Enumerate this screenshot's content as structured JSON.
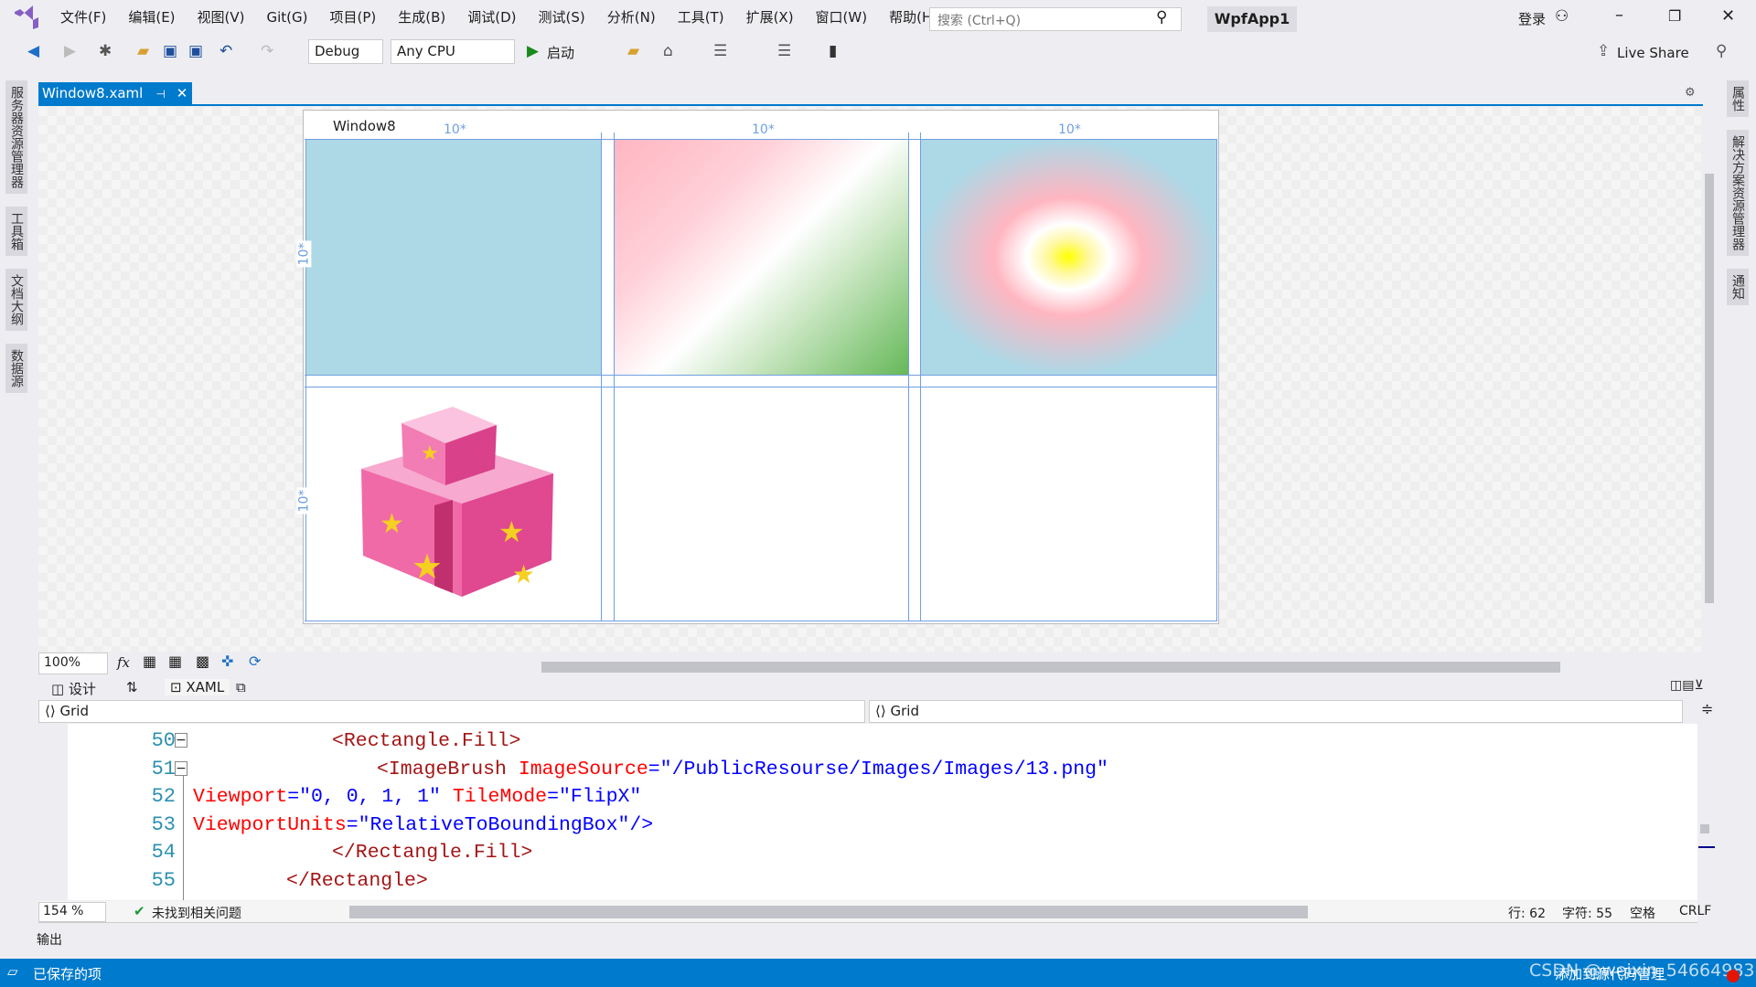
{
  "menubar": {
    "items": [
      "文件(F)",
      "编辑(E)",
      "视图(V)",
      "Git(G)",
      "项目(P)",
      "生成(B)",
      "调试(D)",
      "测试(S)",
      "分析(N)",
      "工具(T)",
      "扩展(X)",
      "窗口(W)",
      "帮助(H)"
    ],
    "search_placeholder": "搜索 (Ctrl+Q)",
    "app_name": "WpfApp1",
    "login": "登录"
  },
  "toolbar": {
    "config": "Debug",
    "platform": "Any CPU",
    "start": "启动",
    "live_share": "Live Share"
  },
  "left_side": [
    "服务器资源管理器",
    "工具箱",
    "文档大纲",
    "数据源"
  ],
  "right_side": [
    "属性",
    "解决方案资源管理器",
    "通知"
  ],
  "tab": {
    "label": "Window8.xaml"
  },
  "designer": {
    "window_title": "Window8",
    "col_widths": [
      "10*",
      "10*",
      "10*"
    ],
    "row_heights": [
      "10*",
      "10*"
    ],
    "zoom": "100%"
  },
  "view_tabs": {
    "design": "设计",
    "xaml": "XAML"
  },
  "nav": {
    "left": "Grid",
    "right": "Grid"
  },
  "code": {
    "line_numbers": [
      "50",
      "51",
      "52",
      "53",
      "54",
      "55"
    ],
    "l50": "<Rectangle.Fill>",
    "l51a": "<ImageBrush ",
    "l51b": "ImageSource",
    "l51c": "=\"/PublicResourse/Images/Images/13.png\"",
    "l52a": "Viewport",
    "l52b": "=\"0, 0, 1, 1\"",
    "l52c": " TileMode",
    "l52d": "=\"FlipX\"",
    "l53a": "ViewportUnits",
    "l53b": "=\"RelativeToBoundingBox\"/>",
    "l54": "</Rectangle.Fill>",
    "l55": "</Rectangle>"
  },
  "editor_status": {
    "zoom": "154 %",
    "issues": "未找到相关问题",
    "line": "行: 62",
    "char": "字符: 55",
    "spaces": "空格",
    "eol": "CRLF"
  },
  "output_label": "输出",
  "statusbar": {
    "text": "已保存的项",
    "right": "添加到源代码管理",
    "watermark": "CSDN @weixin_54664983"
  },
  "colors": {
    "accent": "#007acc",
    "cell1": "#add8e6"
  }
}
